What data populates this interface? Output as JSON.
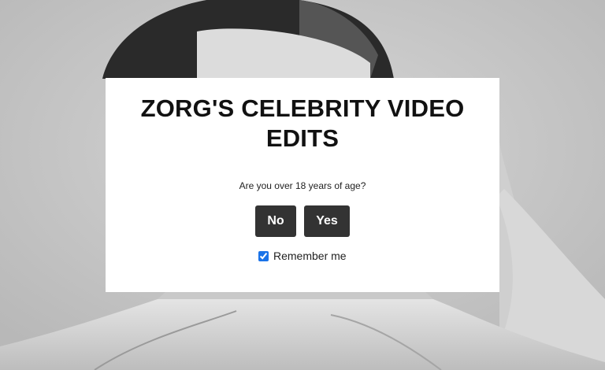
{
  "modal": {
    "title": "ZORG'S CELEBRITY VIDEO EDITS",
    "question": "Are you over 18 years of age?",
    "no_label": "No",
    "yes_label": "Yes",
    "remember_label": "Remember me",
    "remember_checked": true
  },
  "colors": {
    "button_bg": "#333333",
    "modal_bg": "#ffffff",
    "checkbox_accent": "#1a73e8"
  }
}
